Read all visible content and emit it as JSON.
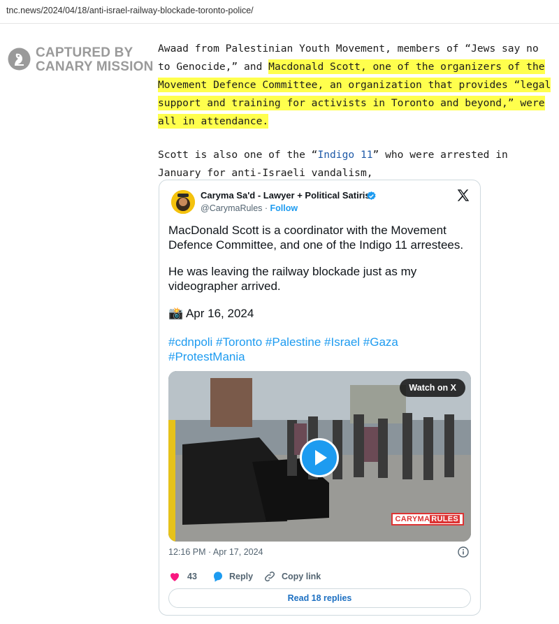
{
  "browser": {
    "url": "tnc.news/2024/04/18/anti-israel-railway-blockade-toronto-police/"
  },
  "watermark": {
    "line1": "CAPTURED BY",
    "line2": "CANARY MISSION"
  },
  "article": {
    "para1_plain": "Awaad from Palestinian Youth Movement, members of “Jews say no to Genocide,” and ",
    "para1_highlight": "Macdonald Scott, one of the organizers of the Movement Defence Committee, an organization that provides “legal support and training for activists in Toronto and beyond,” were all in attendance.",
    "para2_before": "Scott is also one of the “",
    "para2_link": "Indigo 11",
    "para2_after": "” who were arrested in January for anti-Israeli vandalism,"
  },
  "tweet": {
    "author_name": "Caryma Sa'd - Lawyer + Political Satirist",
    "handle": "@CarymaRules",
    "separator": " · ",
    "follow_label": "Follow",
    "body_p1_l1": "MacDonald Scott is a coordinator with the Movement",
    "body_p1_l2": "Defence Committee, and one of the Indigo 11 arrestees.",
    "body_p2_l1": "He was leaving the railway blockade just as my",
    "body_p2_l2": "videographer arrived.",
    "date_emoji": "📸",
    "date_text": "Apr 16, 2024",
    "hashtags_l1": "#cdnpoli #Toronto #Palestine #Israel #Gaza",
    "hashtags_l2": "#ProtestMania",
    "watch_label": "Watch on X",
    "video_brand_a": "CARYMA",
    "video_brand_b": "RULES",
    "timestamp": "12:16 PM · Apr 17, 2024",
    "likes_count": "43",
    "reply_label": "Reply",
    "copy_link_label": "Copy link",
    "read_replies_label": "Read 18 replies",
    "icons": [
      "verified-icon",
      "x-logo-icon",
      "info-icon",
      "heart-icon",
      "reply-icon",
      "link-icon",
      "play-icon",
      "camera-icon"
    ],
    "colors": {
      "link_blue": "#1d9bf0",
      "like_pink": "#f91880",
      "highlight": "#ffff4d"
    }
  }
}
